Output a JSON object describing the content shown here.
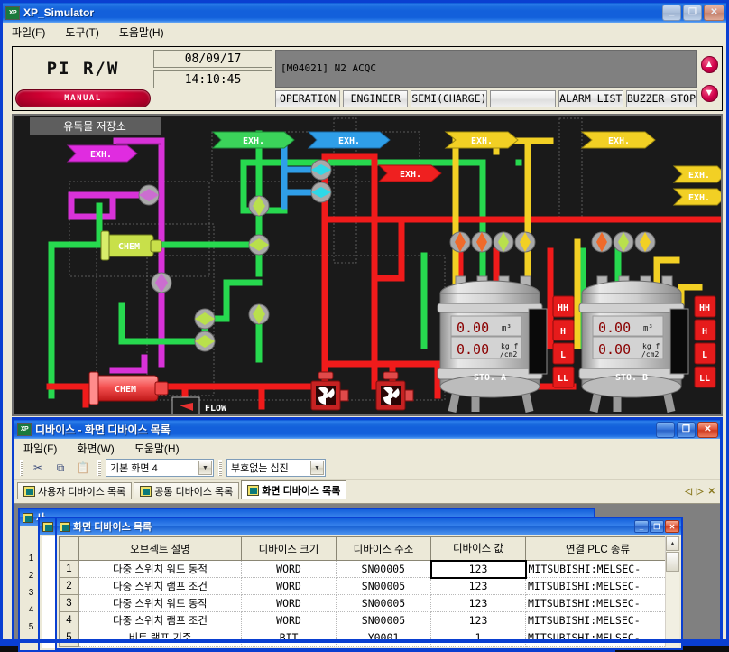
{
  "app": {
    "title": "XP_Simulator",
    "icon": "xp-icon",
    "menu": [
      {
        "label": "파일(F)",
        "name": "menu-file"
      },
      {
        "label": "도구(T)",
        "name": "menu-tools"
      },
      {
        "label": "도움말(H)",
        "name": "menu-help"
      }
    ],
    "window_buttons": {
      "minimize": "_",
      "maximize": "❐",
      "close": "✕"
    }
  },
  "control_panel": {
    "pi_label": "PI R/W",
    "mode_button": "MANUAL",
    "date": "08/09/17",
    "time": "14:10:45",
    "message": "[M04021] N2 ACQC",
    "buttons": [
      {
        "label": "OPERATION",
        "name": "operation-button"
      },
      {
        "label": "ENGINEER",
        "name": "engineer-button"
      },
      {
        "label": "SEMI(CHARGE)",
        "name": "semi-charge-button"
      },
      {
        "label": "",
        "name": "blank-button"
      },
      {
        "label": "ALARM LIST",
        "name": "alarm-list-button"
      },
      {
        "label": "BUZZER STOP",
        "name": "buzzer-stop-button"
      }
    ],
    "scroll_up": "▲",
    "scroll_down": "▼"
  },
  "diagram": {
    "section_title": "유독물 저장소",
    "tags": [
      {
        "text": "EXH.",
        "color": "#3bd35a"
      },
      {
        "text": "EXH.",
        "color": "#2f9ee8"
      },
      {
        "text": "EXH.",
        "color": "#ef2020"
      },
      {
        "text": "EXH.",
        "color": "#f2d024"
      },
      {
        "text": "EXH.",
        "color": "#f2d024"
      },
      {
        "text": "EXH.",
        "color": "#f2d024"
      },
      {
        "text": "EXH.",
        "color": "#f2d024"
      },
      {
        "text": "EXH.",
        "color": "#d832d8"
      }
    ],
    "exh_label": "EXH.",
    "exhaust_label": "EXH.",
    "chem_label": "CHEM",
    "flow_label": "FLOW",
    "tanks": [
      {
        "name": "STO. A",
        "volume_value": "0.00",
        "volume_unit": "m³",
        "pressure_value": "0.00",
        "pressure_unit_1": "kg f",
        "pressure_unit_2": "/cm2",
        "alarms": [
          "HH",
          "H",
          "L",
          "LL"
        ]
      },
      {
        "name": "STO. B",
        "volume_value": "0.00",
        "volume_unit": "m³",
        "pressure_value": "0.00",
        "pressure_unit_1": "kg f",
        "pressure_unit_2": "/cm2",
        "alarms": [
          "HH",
          "H",
          "L",
          "LL"
        ]
      }
    ],
    "colors": {
      "green": "#27d94f",
      "red": "#f01b1b",
      "yellow": "#f2d024",
      "magenta": "#e02ce0",
      "blue": "#2f9ee8",
      "background": "#1a1a1a"
    }
  },
  "device_window": {
    "title": "디바이스 - 화면 디바이스 목록",
    "menu": [
      {
        "label": "파일(F)",
        "name": "dev-menu-file"
      },
      {
        "label": "화면(W)",
        "name": "dev-menu-screen"
      },
      {
        "label": "도움말(H)",
        "name": "dev-menu-help"
      }
    ],
    "toolbar": {
      "cut_icon": "✂",
      "copy_icon": "⧉",
      "paste_icon": "📋",
      "screen_select": "기본 화면 4",
      "format_select": "부호없는 십진"
    },
    "tabs": [
      {
        "label": "사용자 디바이스 목록",
        "name": "tab-user-device-list",
        "active": false
      },
      {
        "label": "공통 디바이스 목록",
        "name": "tab-common-device-list",
        "active": false
      },
      {
        "label": "화면 디바이스 목록",
        "name": "tab-screen-device-list",
        "active": true
      }
    ],
    "tab_nav": {
      "prev": "◁",
      "next": "▷",
      "close": "✕"
    }
  },
  "child_window": {
    "title": "화면 디바이스 목록",
    "headers": [
      "",
      "오브젝트 설명",
      "디바이스 크기",
      "디바이스 주소",
      "디바이스 값",
      "연결 PLC 종류"
    ],
    "rows": [
      {
        "no": "1",
        "desc": "다중 스위치 워드 동적",
        "size": "WORD",
        "address": "SN00005",
        "value": "123",
        "plc": "MITSUBISHI:MELSEC-",
        "selected": true
      },
      {
        "no": "2",
        "desc": "다중 스위치 램프 조건",
        "size": "WORD",
        "address": "SN00005",
        "value": "123",
        "plc": "MITSUBISHI:MELSEC-",
        "selected": false
      },
      {
        "no": "3",
        "desc": "다중 스위치 워드 동작",
        "size": "WORD",
        "address": "SN00005",
        "value": "123",
        "plc": "MITSUBISHI:MELSEC-",
        "selected": false
      },
      {
        "no": "4",
        "desc": "다중 스위치 램프 조건",
        "size": "WORD",
        "address": "SN00005",
        "value": "123",
        "plc": "MITSUBISHI:MELSEC-",
        "selected": false
      },
      {
        "no": "5",
        "desc": "비트 램프 기준",
        "size": "BIT",
        "address": "Y0001",
        "value": "1",
        "plc": "MITSUBISHI:MELSEC-",
        "selected": false
      }
    ],
    "scrollbar": {
      "up": "▲",
      "down": "▼"
    }
  },
  "background_child_windows": [
    {
      "title_fragment": "사",
      "name": "background-window-1"
    },
    {
      "title_fragment": "",
      "name": "background-window-2"
    }
  ]
}
